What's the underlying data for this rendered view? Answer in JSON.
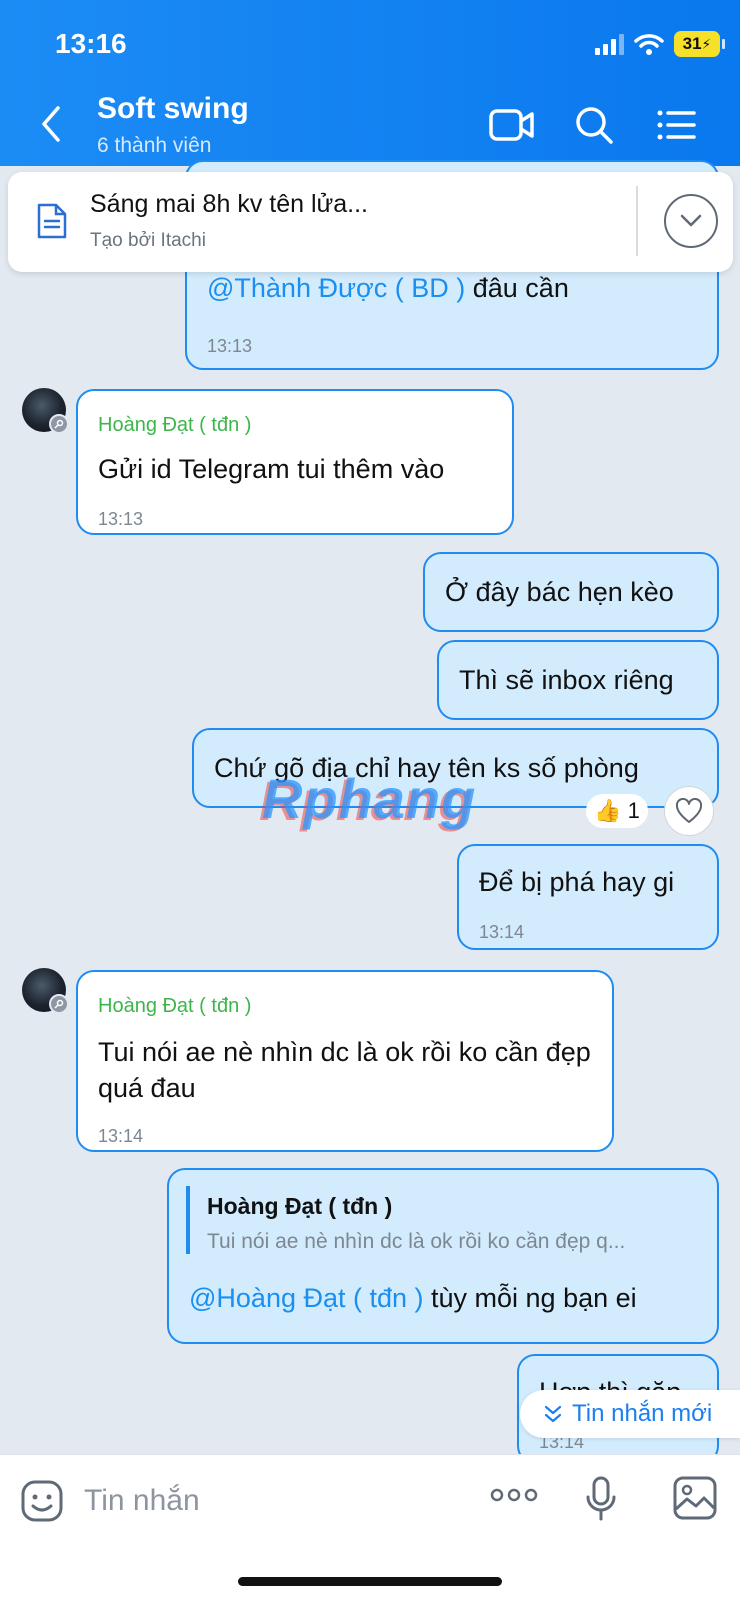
{
  "status_bar": {
    "time": "13:16",
    "battery": "31"
  },
  "header": {
    "title": "Soft swing",
    "subtitle": "6 thành viên"
  },
  "pinned": {
    "text": "Sáng mai 8h kv tên lửa...",
    "creator": "Tạo bởi Itachi"
  },
  "messages": {
    "m1": {
      "mention": "@Thành Được ( BD )",
      "text": " đâu cần",
      "time": "13:13"
    },
    "m2": {
      "sender": "Hoàng Đạt ( tđn )",
      "text": "Gửi id Telegram tui thêm vào",
      "time": "13:13"
    },
    "m3": {
      "text": "Ở đây bác hẹn kèo"
    },
    "m4": {
      "text": "Thì sẽ inbox riêng"
    },
    "m5": {
      "text": "Chứ gõ địa chỉ hay tên ks số phòng",
      "reaction_count": "1"
    },
    "m6": {
      "text": "Để bị phá hay gi",
      "time": "13:14"
    },
    "m7": {
      "sender": "Hoàng Đạt ( tđn )",
      "text": "Tui nói ae nè nhìn dc là ok rồi ko cần đẹp quá đau",
      "time": "13:14"
    },
    "m8": {
      "reply_sender": "Hoàng Đạt ( tđn )",
      "reply_text": "Tui nói ae nè nhìn dc là ok rồi ko cần đẹp q...",
      "mention": "@Hoàng Đạt ( tđn )",
      "text": " tùy mỗi ng bạn ei"
    },
    "m9": {
      "text": "Hợp thì gặp",
      "time": "13:14"
    }
  },
  "watermark": "Rphang",
  "new_messages_label": "Tin nhắn mới",
  "input": {
    "placeholder": "Tin nhắn"
  },
  "colors": {
    "header": "#0a78ee",
    "bubble_out": "#d3ecfd",
    "bubble_border": "#1f8cf2",
    "sender": "#3cb54a",
    "mention": "#1a8ff0"
  }
}
